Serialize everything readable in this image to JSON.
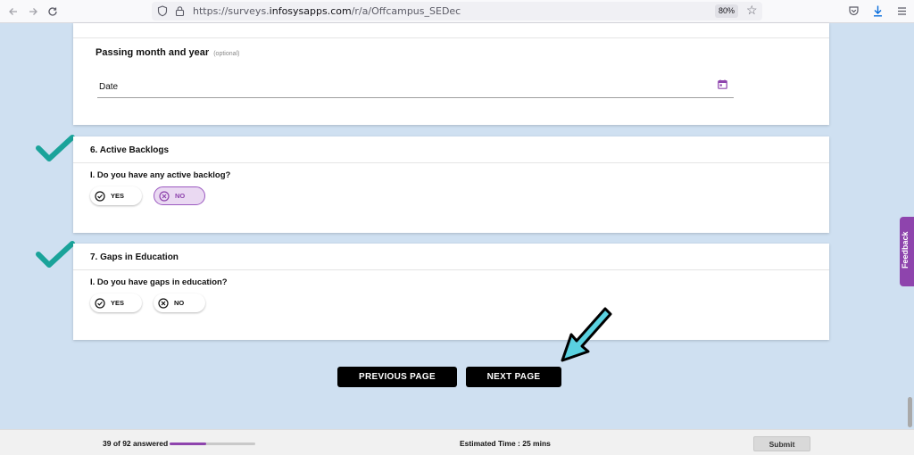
{
  "browser": {
    "url_prefix": "https://surveys.",
    "url_host": "infosysapps.com",
    "url_path": "/r/a/Offcampus_SEDec",
    "zoom": "80%"
  },
  "section_top": {
    "field_label": "Passing month and year",
    "field_optional": "(optional)",
    "date_placeholder": "Date"
  },
  "section6": {
    "heading": "6.  Active Backlogs",
    "question": "I.  Do you have any active backlog?",
    "yes_label": "YES",
    "no_label": "NO",
    "selected": "NO"
  },
  "section7": {
    "heading": "7.  Gaps in Education",
    "question": "I.  Do you have gaps in education?",
    "yes_label": "YES",
    "no_label": "NO"
  },
  "navigation": {
    "previous_label": "PREVIOUS PAGE",
    "next_label": "NEXT PAGE"
  },
  "feedback_label": "Feedback",
  "footer": {
    "progress_text": "39 of 92 answered",
    "answered": 39,
    "total": 92,
    "estimated_time": "Estimated Time : 25 mins",
    "submit_label": "Submit"
  },
  "colors": {
    "accent": "#8e44ad",
    "check": "#1aa39a",
    "arrow_fill": "#5ad1e0",
    "page_background": "#cfe0f1"
  },
  "icons": {
    "back": "arrow-left-icon",
    "forward": "arrow-right-icon",
    "reload": "reload-icon",
    "shield": "shield-icon",
    "lock": "lock-icon",
    "star": "star-icon",
    "pocket": "pocket-icon",
    "download": "download-icon",
    "menu": "hamburger-menu-icon",
    "calendar": "calendar-icon",
    "yes": "check-circle-icon",
    "no": "x-circle-icon"
  }
}
